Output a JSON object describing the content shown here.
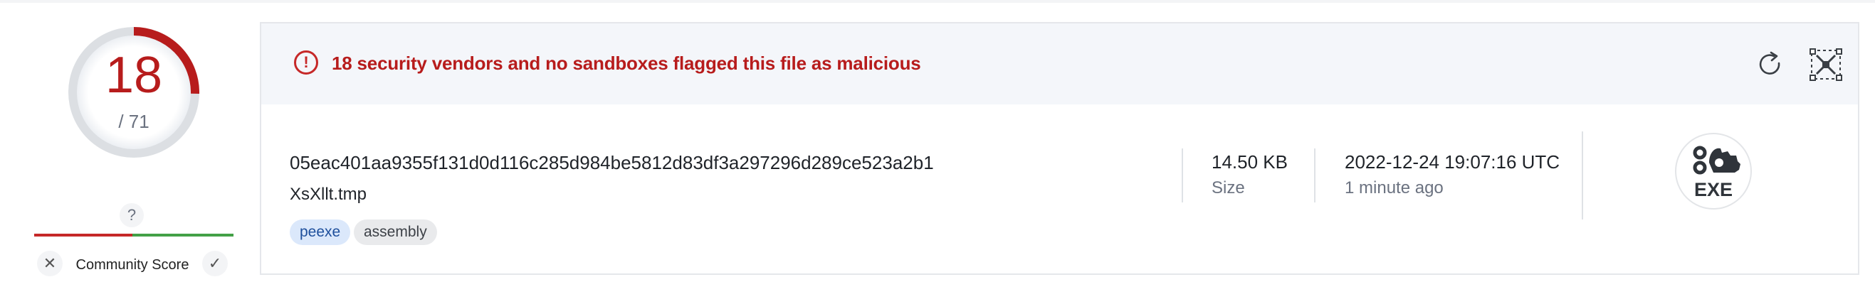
{
  "detection": {
    "malicious_count": "18",
    "total_label": "/ 71",
    "ratio": 0.2535,
    "ring_color": "#b71c1c"
  },
  "community": {
    "question_mark": "?",
    "label": "Community Score",
    "negative_icon": "close-icon",
    "positive_icon": "checkmark-icon",
    "negative_glyph": "✕",
    "positive_glyph": "✓"
  },
  "alert": {
    "icon_glyph": "!",
    "text": "18 security vendors and no sandboxes flagged this file as malicious",
    "color": "#b71c1c"
  },
  "toolbar": {
    "reanalyze_icon": "reanalyze-icon",
    "similar_icon": "similar-files-icon"
  },
  "file": {
    "hash": "05eac401aa9355f131d0d116c285d984be5812d83df3a297296d289ce523a2b1",
    "name": "XsXllt.tmp",
    "tags": [
      "peexe",
      "assembly"
    ],
    "size_value": "14.50 KB",
    "size_label": "Size",
    "date_value": "2022-12-24 19:07:16 UTC",
    "date_relative": "1 minute ago",
    "type_icon_label": "EXE"
  }
}
